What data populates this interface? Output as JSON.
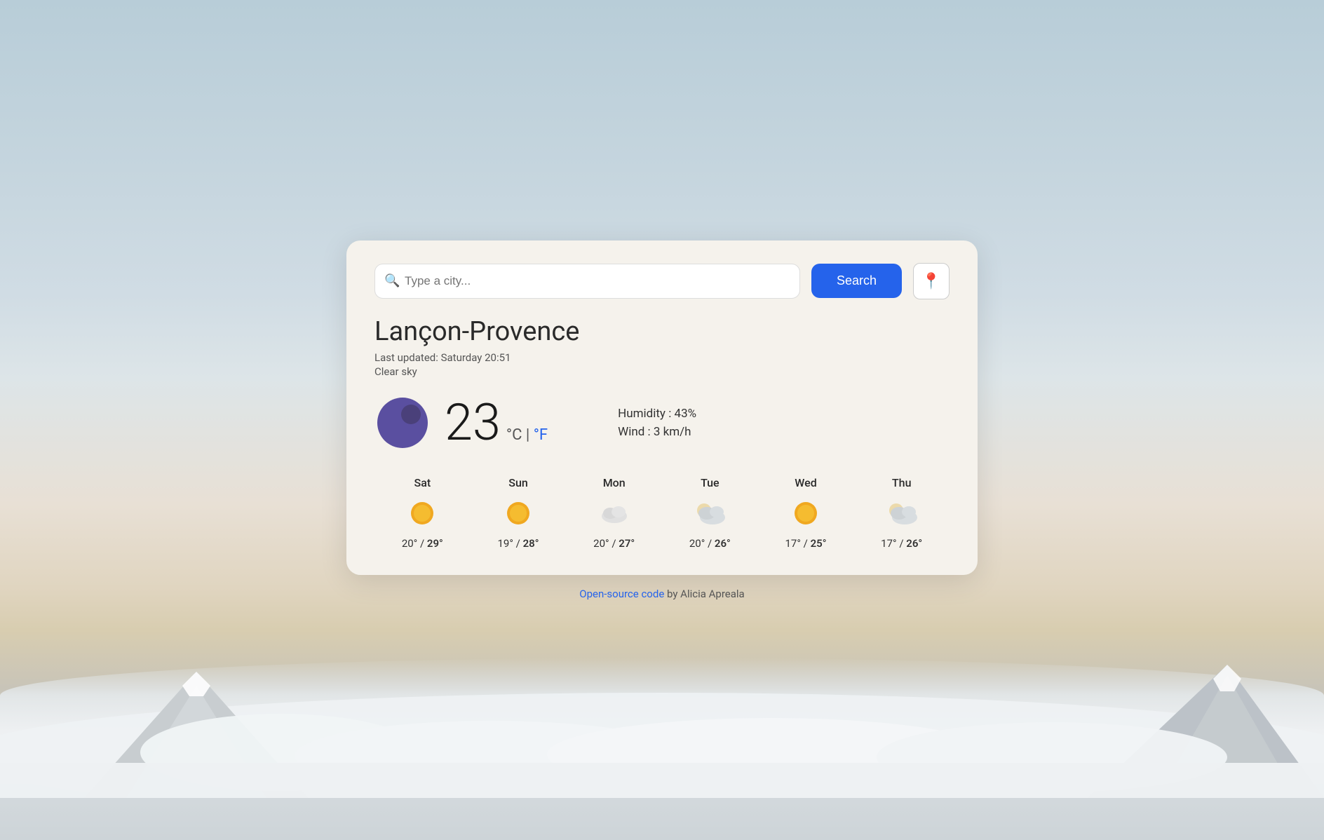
{
  "background": {
    "gradient_desc": "sky gradient with mountain clouds"
  },
  "search": {
    "placeholder": "Type a city...",
    "button_label": "Search",
    "location_icon": "📍"
  },
  "city": {
    "name": "Lançon-Provence",
    "last_updated": "Last updated: Saturday 20:51",
    "condition": "Clear sky"
  },
  "current": {
    "temperature": "23",
    "unit_c": "°C",
    "separator": " | ",
    "unit_f": "°F",
    "humidity_label": "Humidity : 43%",
    "wind_label": "Wind : 3 km/h"
  },
  "forecast": [
    {
      "day": "Sat",
      "temp_low": "20°",
      "temp_high": "29°",
      "type": "sunny"
    },
    {
      "day": "Sun",
      "temp_low": "19°",
      "temp_high": "28°",
      "type": "sunny"
    },
    {
      "day": "Mon",
      "temp_low": "20°",
      "temp_high": "27°",
      "type": "cloudy"
    },
    {
      "day": "Tue",
      "temp_low": "20°",
      "temp_high": "26°",
      "type": "partly-cloudy"
    },
    {
      "day": "Wed",
      "temp_low": "17°",
      "temp_high": "25°",
      "type": "sunny"
    },
    {
      "day": "Thu",
      "temp_low": "17°",
      "temp_high": "26°",
      "type": "partly-cloudy"
    }
  ],
  "footer": {
    "link_text": "Open-source code",
    "author": " by Alicia Apreala"
  }
}
